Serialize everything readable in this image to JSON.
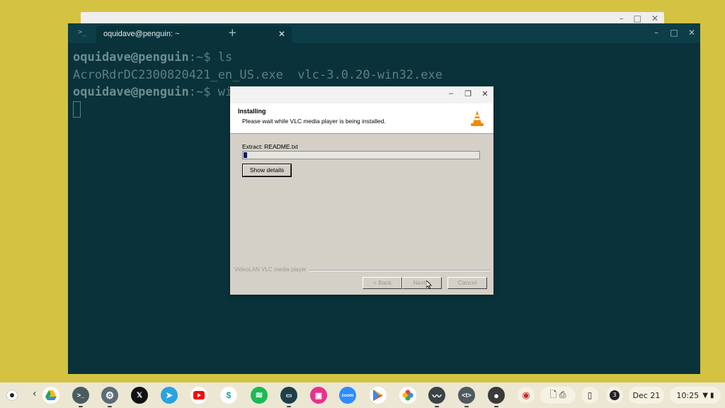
{
  "terminal": {
    "tab_title": "oquidave@penguin: ~",
    "lines": [
      {
        "user": "oquidave@penguin",
        "path": ":~$",
        "cmd": " ls"
      },
      {
        "output": "AcroRdrDC2300820421_en_US.exe  vlc-3.0.20-win32.exe"
      },
      {
        "user": "oquidave@penguin",
        "path": ":~$",
        "cmd": " win"
      }
    ]
  },
  "installer": {
    "heading": "Installing",
    "subheading": "Please wait while VLC media player is being installed.",
    "status": "Extract: README.txt",
    "progress": 0.02,
    "show_details": "Show details",
    "brand": "VideoLAN VLC media player",
    "back": "< Back",
    "next": "Next >",
    "cancel": "Cancel"
  },
  "shelf": {
    "date": "Dec 21",
    "time": "10:25",
    "notification_count": "3",
    "zoom_label": "zoom"
  }
}
